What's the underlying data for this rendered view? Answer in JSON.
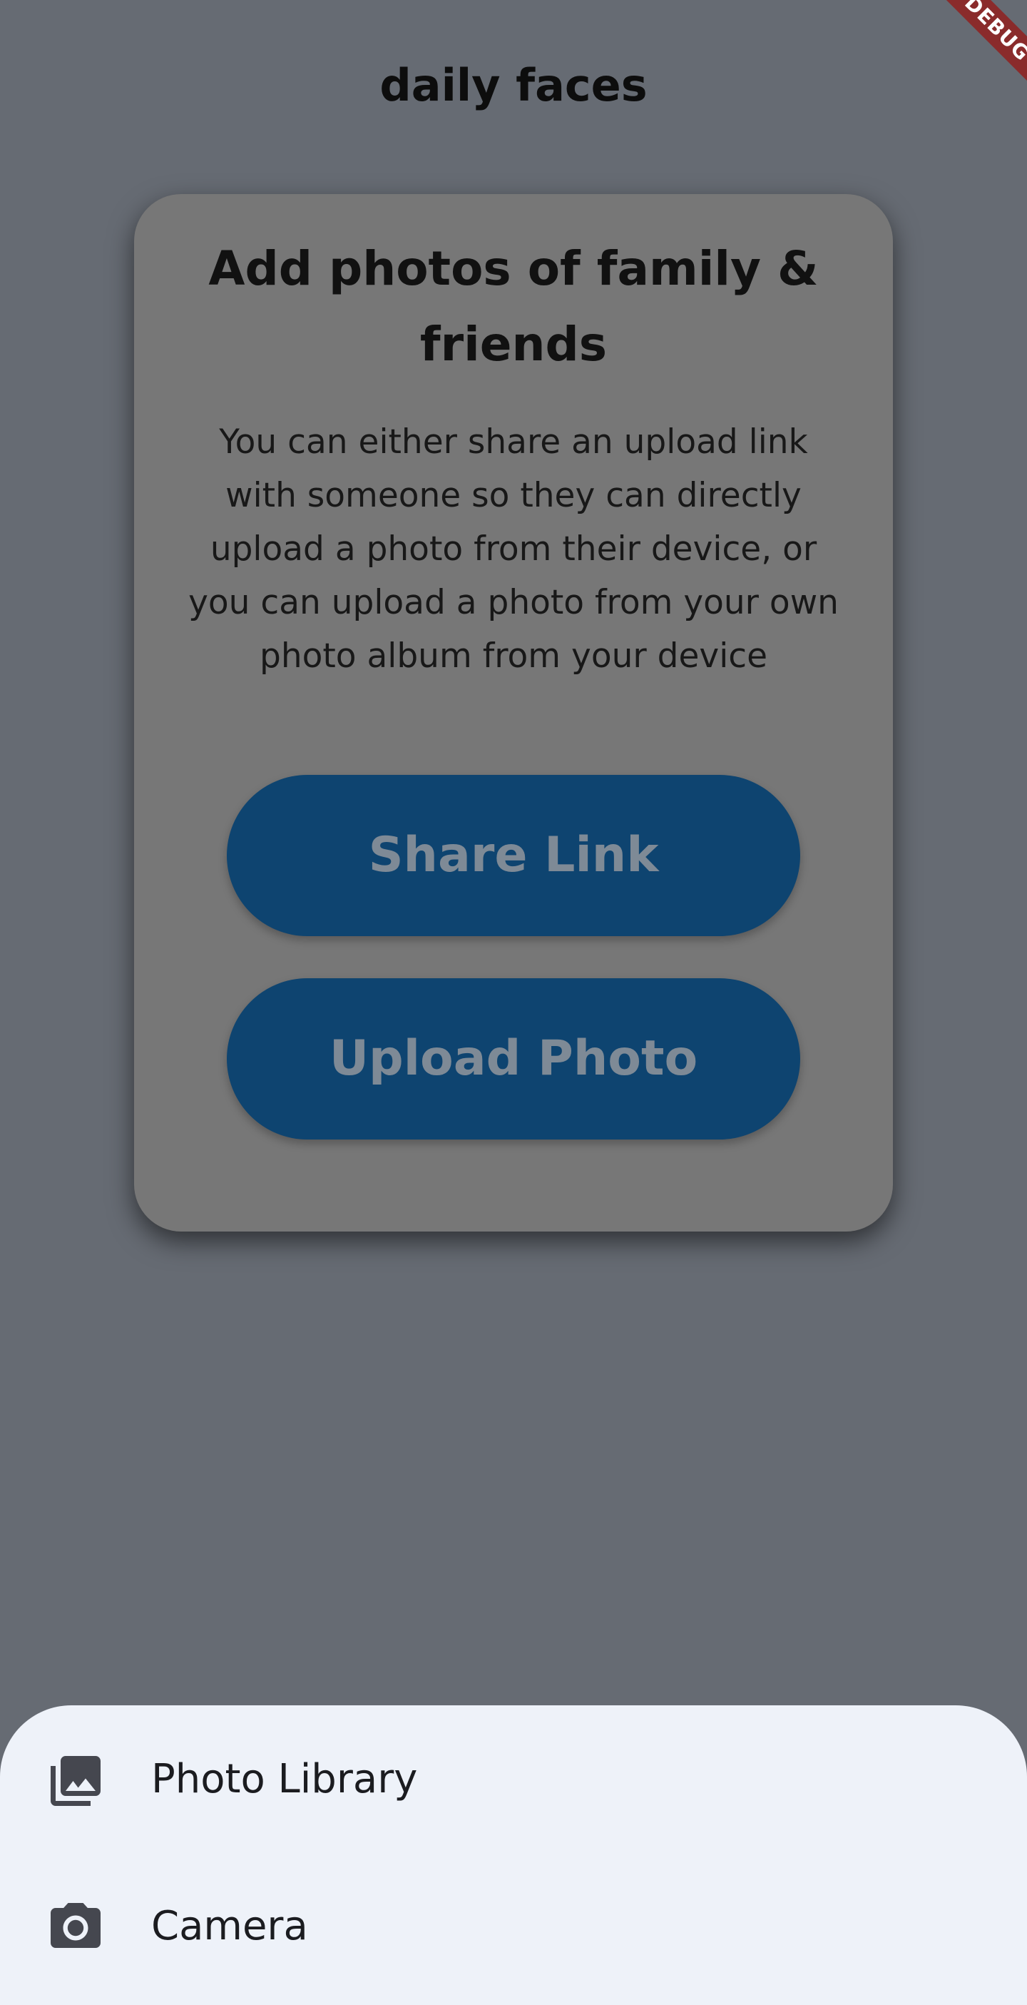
{
  "app_bar": {
    "title": "daily faces",
    "debug_banner": "DEBUG"
  },
  "card": {
    "heading": "Add photos of family & friends",
    "description": "You can either share an upload link with someone so they can directly upload a photo from their device, or you can upload a photo from your own photo album from your device",
    "share_button_label": "Share Link",
    "upload_button_label": "Upload Photo"
  },
  "bottom_sheet": {
    "items": [
      {
        "label": "Photo Library",
        "icon": "photo-library-icon"
      },
      {
        "label": "Camera",
        "icon": "camera-icon"
      }
    ]
  },
  "colors": {
    "scrim_background": "#666b73",
    "card_background": "#777777",
    "button_background": "#0e4470",
    "button_text": "#7e8a96",
    "sheet_background": "#eef2f9",
    "debug_ribbon": "#8a2b2b"
  }
}
